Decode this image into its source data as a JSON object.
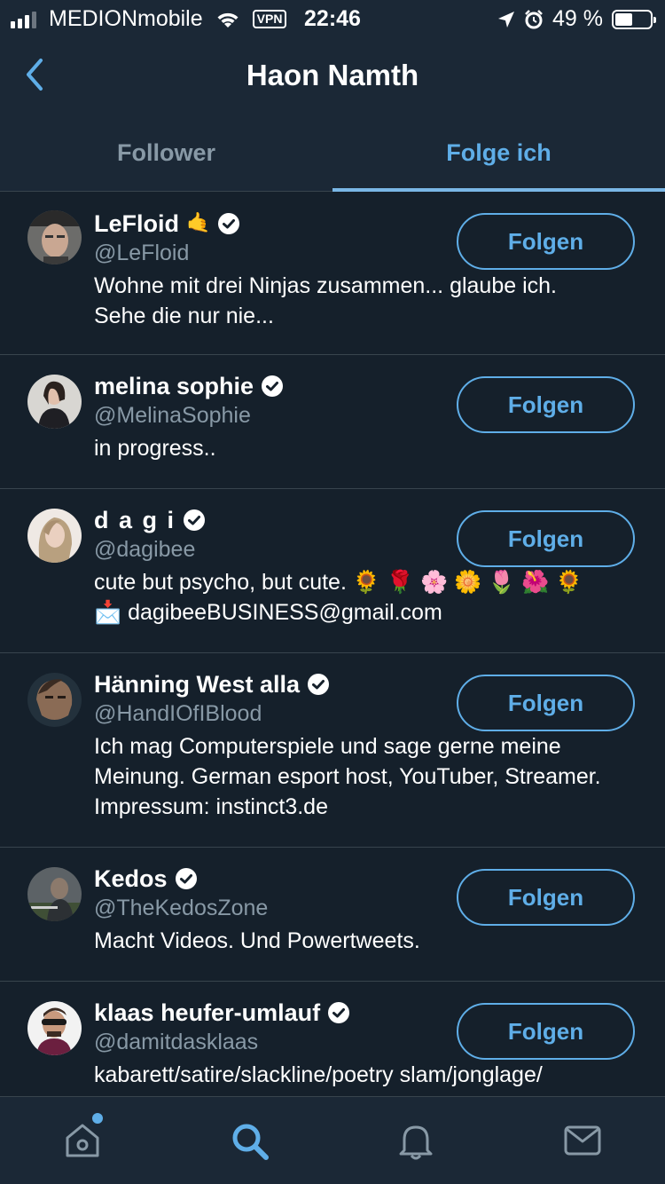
{
  "status_bar": {
    "carrier": "MEDIONmobile",
    "vpn": "VPN",
    "time": "22:46",
    "battery_percent": "49 %",
    "battery_level": 0.49
  },
  "header": {
    "title": "Haon Namth",
    "back_icon": "chevron-left-icon"
  },
  "tabs": [
    {
      "label": "Follower",
      "active": false
    },
    {
      "label": "Folge ich",
      "active": true
    }
  ],
  "users": [
    {
      "name": "LeFloid",
      "name_emoji": "🤙",
      "handle": "@LeFloid",
      "bio": "Wohne mit drei Ninjas zusammen... glaube ich. Sehe die nur nie...",
      "button": "Folgen",
      "verified": true
    },
    {
      "name": "melina sophie",
      "handle": "@MelinaSophie",
      "bio": "in progress..",
      "button": "Folgen",
      "verified": true
    },
    {
      "name": "d a g i",
      "handle": "@dagibee",
      "bio": "cute but psycho, but cute. 🌻 🌹 🌸 🌼 🌷 🌺 🌻",
      "bio_line2": "📩 dagibeeBUSINESS@gmail.com",
      "button": "Folgen",
      "verified": true
    },
    {
      "name": "Hänning West alla",
      "handle": "@HandIOfIBlood",
      "bio": "Ich mag Computerspiele und sage gerne meine Meinung. German esport host, YouTuber, Streamer. Impressum: instinct3.de",
      "button": "Folgen",
      "verified": true
    },
    {
      "name": "Kedos",
      "handle": "@TheKedosZone",
      "bio": "Macht Videos. Und Powertweets.",
      "button": "Folgen",
      "verified": true
    },
    {
      "name": "klaas heufer-umlauf",
      "handle": "@damitdasklaas",
      "bio": "kabarett/satire/slackline/poetry slam/jonglage/",
      "button": "Folgen",
      "verified": true
    }
  ],
  "bottom_nav": [
    {
      "icon": "home-icon",
      "notification_dot": true
    },
    {
      "icon": "search-icon",
      "active": true
    },
    {
      "icon": "bell-icon"
    },
    {
      "icon": "mail-icon"
    }
  ],
  "colors": {
    "background": "#15202b",
    "bar": "#1b2836",
    "accent": "#5faee8",
    "secondary_text": "#8899a6",
    "divider": "#38444d"
  }
}
